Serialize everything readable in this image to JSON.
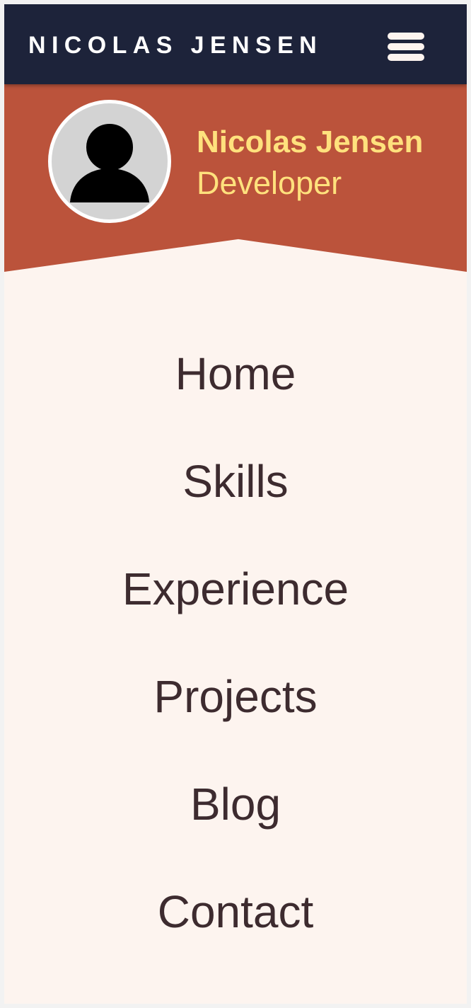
{
  "navbar": {
    "brand": "NICOLAS JENSEN",
    "menu_icon": "hamburger-menu-icon"
  },
  "profile": {
    "name": "Nicolas Jensen",
    "role": "Developer",
    "avatar_icon": "user-avatar-icon"
  },
  "menu": {
    "items": [
      {
        "label": "Home"
      },
      {
        "label": "Skills"
      },
      {
        "label": "Experience"
      },
      {
        "label": "Projects"
      },
      {
        "label": "Blog"
      },
      {
        "label": "Contact"
      }
    ]
  },
  "colors": {
    "navbar_bg": "#1d233a",
    "hero_bg": "#bb533b",
    "accent_text": "#ffe17d",
    "page_bg": "#fdf4ef",
    "menu_text": "#3d2b2f"
  }
}
